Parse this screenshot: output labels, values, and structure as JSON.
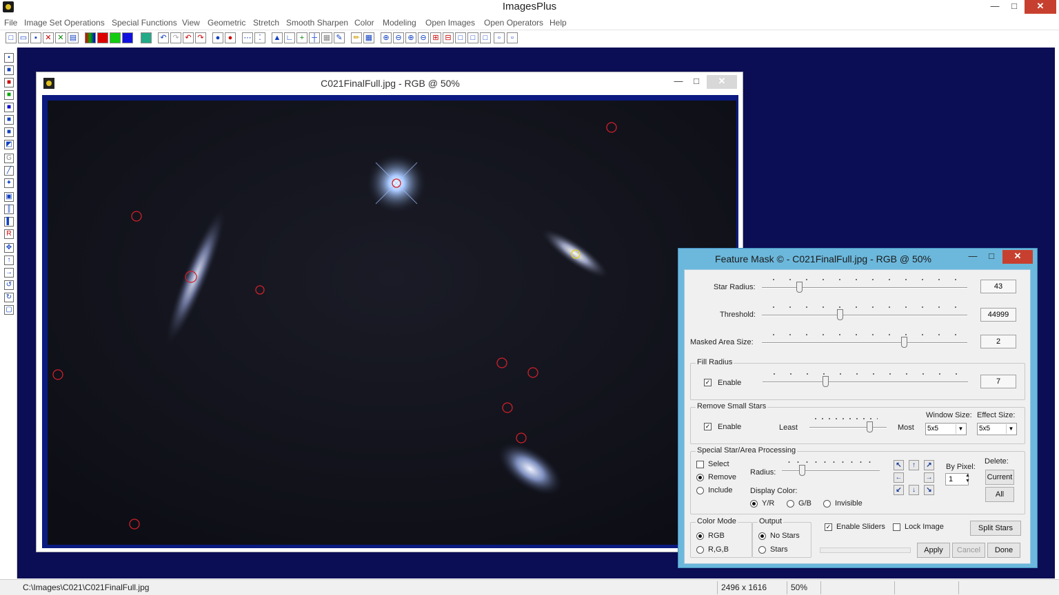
{
  "app": {
    "title": "ImagesPlus",
    "minimize": "—",
    "maximize": "□",
    "close": "✕"
  },
  "menu": [
    "File",
    "Image Set Operations",
    "Special Functions",
    "View",
    "Geometric",
    "Stretch",
    "Smooth Sharpen",
    "Color",
    "Modeling",
    "Open Images",
    "Open Operators",
    "Help"
  ],
  "image_window": {
    "title": "C021FinalFull.jpg - RGB @ 50%",
    "minimize": "—",
    "maximize": "□",
    "close": "✕"
  },
  "dialog": {
    "title": "Feature Mask © - C021FinalFull.jpg - RGB @ 50%",
    "minimize": "—",
    "maximize": "□",
    "close": "✕",
    "star_radius_label": "Star Radius:",
    "star_radius_value": "43",
    "threshold_label": "Threshold:",
    "threshold_value": "44999",
    "masked_area_label": "Masked Area Size:",
    "masked_area_value": "2",
    "fill_radius_group": "Fill Radius",
    "fill_radius_enable": "Enable",
    "fill_radius_value": "7",
    "remove_small_group": "Remove Small Stars",
    "remove_small_enable": "Enable",
    "least_label": "Least",
    "most_label": "Most",
    "window_size_label": "Window Size:",
    "window_size_value": "5x5",
    "effect_size_label": "Effect Size:",
    "effect_size_value": "5x5",
    "special_group": "Special Star/Area Processing",
    "select_label": "Select",
    "remove_label": "Remove",
    "include_label": "Include",
    "radius_label": "Radius:",
    "display_color_label": "Display Color:",
    "yr_label": "Y/R",
    "gb_label": "G/B",
    "invisible_label": "Invisible",
    "by_pixel_label": "By Pixel:",
    "by_pixel_value": "1",
    "delete_label": "Delete:",
    "current_button": "Current",
    "all_button": "All",
    "color_mode_group": "Color Mode",
    "rgb_label": "RGB",
    "rgb_sep_label": "R,G,B",
    "output_group": "Output",
    "no_stars_label": "No Stars",
    "stars_label": "Stars",
    "enable_sliders_label": "Enable Sliders",
    "lock_image_label": "Lock Image",
    "split_stars_button": "Split Stars",
    "apply_button": "Apply",
    "cancel_button": "Cancel",
    "done_button": "Done"
  },
  "status": {
    "path": "C:\\Images\\C021\\C021FinalFull.jpg",
    "dimensions": "2496 x 1616",
    "zoom": "50%"
  },
  "colors": {
    "workspace": "#0b0d55",
    "dialog_frame": "#6cb8dc",
    "close_red": "#c7402f",
    "marker_red": "#d0202a",
    "marker_yellow": "#e8d020"
  }
}
